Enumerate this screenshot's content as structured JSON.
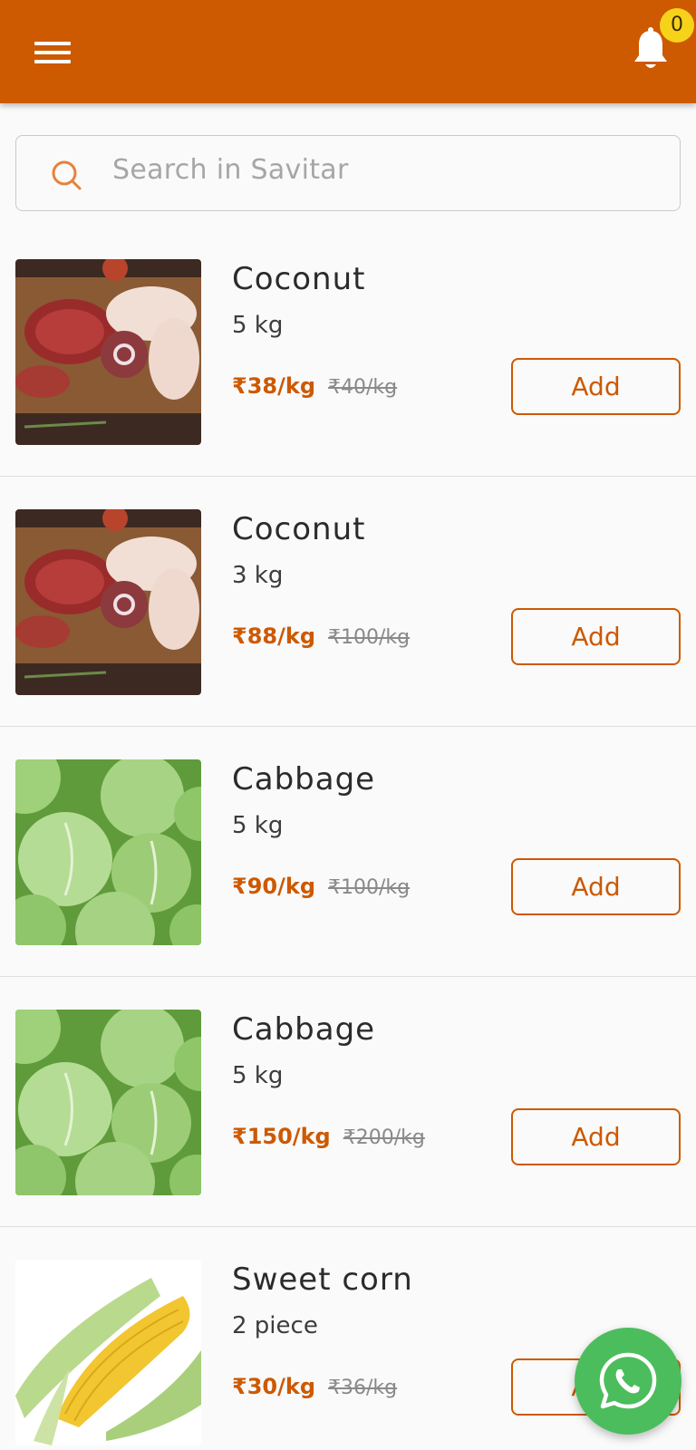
{
  "header": {
    "menu_icon": "menu-icon",
    "notification_icon": "bell-icon",
    "notification_count": "0",
    "accent_color": "#cd5900"
  },
  "search": {
    "placeholder": "Search in Savitar",
    "icon": "search-icon"
  },
  "products": [
    {
      "name": "Coconut",
      "quantity": "5 kg",
      "price": "₹38/kg",
      "old_price": "₹40/kg",
      "add_label": "Add",
      "image": "meat-platter"
    },
    {
      "name": "Coconut",
      "quantity": "3 kg",
      "price": "₹88/kg",
      "old_price": "₹100/kg",
      "add_label": "Add",
      "image": "meat-platter"
    },
    {
      "name": "Cabbage",
      "quantity": "5 kg",
      "price": "₹90/kg",
      "old_price": "₹100/kg",
      "add_label": "Add",
      "image": "cabbage"
    },
    {
      "name": "Cabbage",
      "quantity": "5 kg",
      "price": "₹150/kg",
      "old_price": "₹200/kg",
      "add_label": "Add",
      "image": "cabbage"
    },
    {
      "name": "Sweet corn",
      "quantity": "2 piece",
      "price": "₹30/kg",
      "old_price": "₹36/kg",
      "add_label": "Add",
      "image": "corn"
    }
  ],
  "fab": {
    "icon": "whatsapp-icon",
    "color": "#4cbd5c"
  }
}
